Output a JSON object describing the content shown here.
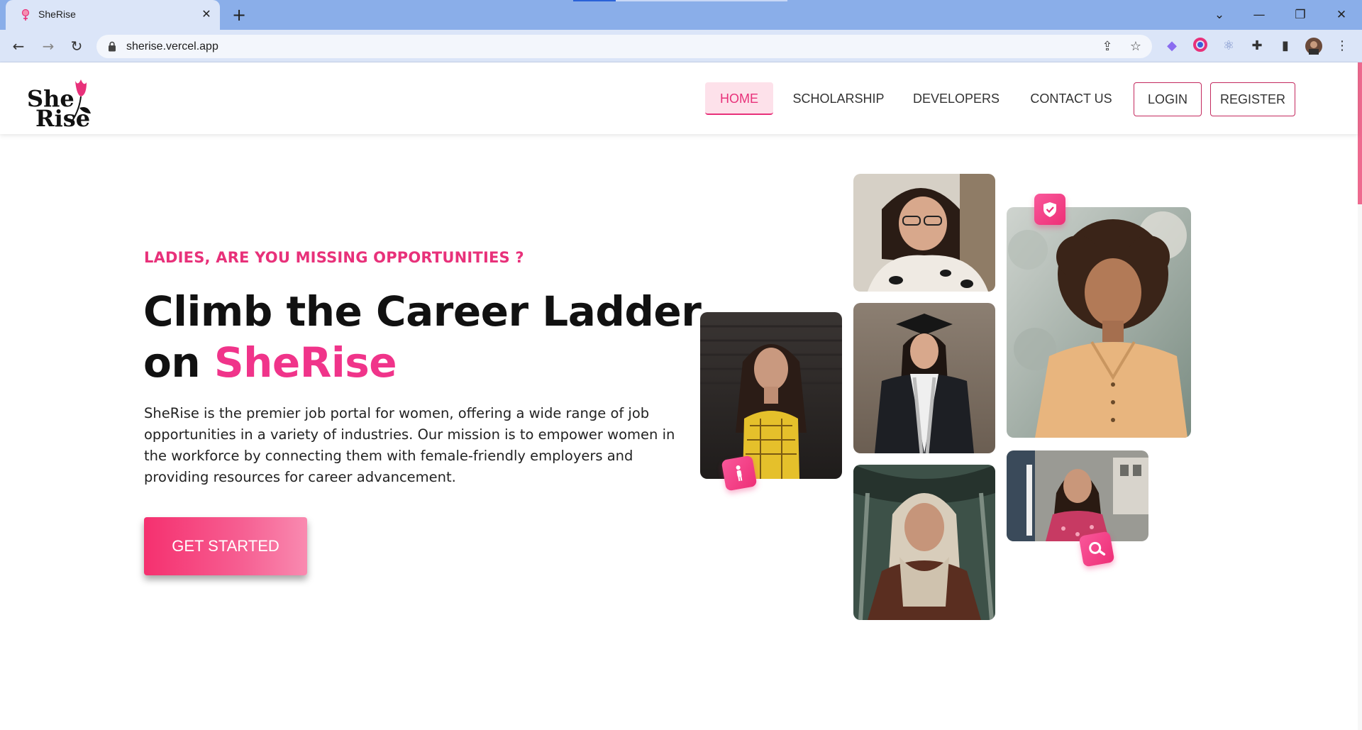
{
  "browser": {
    "tab_title": "SheRise",
    "url": "sherise.vercel.app"
  },
  "icons": {
    "favicon": "female-symbol-icon",
    "lock": "lock-icon",
    "share": "share-icon",
    "star": "bookmark-star-icon",
    "shield": "shield-check-icon",
    "person": "person-icon",
    "search": "search-icon"
  },
  "site": {
    "logo": {
      "line1": "She",
      "line2": "Rise"
    },
    "nav": {
      "home": "HOME",
      "scholarship": "SCHOLARSHIP",
      "developers": "DEVELOPERS",
      "contact": "CONTACT US",
      "login": "LOGIN",
      "register": "REGISTER"
    }
  },
  "hero": {
    "eyebrow": "LADIES, ARE YOU MISSING OPPORTUNITIES ?",
    "headline_line1": "Climb the Career Ladder",
    "headline_line2_prefix": "on ",
    "headline_brand": "SheRise",
    "description": "SheRise is the premier job portal for women, offering a wide range of job opportunities in a variety of industries. Our mission is to empower women in the workforce by connecting them with female-friendly employers and providing resources for career advancement.",
    "cta": "GET STARTED"
  },
  "colors": {
    "brand_pink": "#f0348a",
    "accent_pink": "#e8317a",
    "chrome_blue": "#8aaee9"
  }
}
